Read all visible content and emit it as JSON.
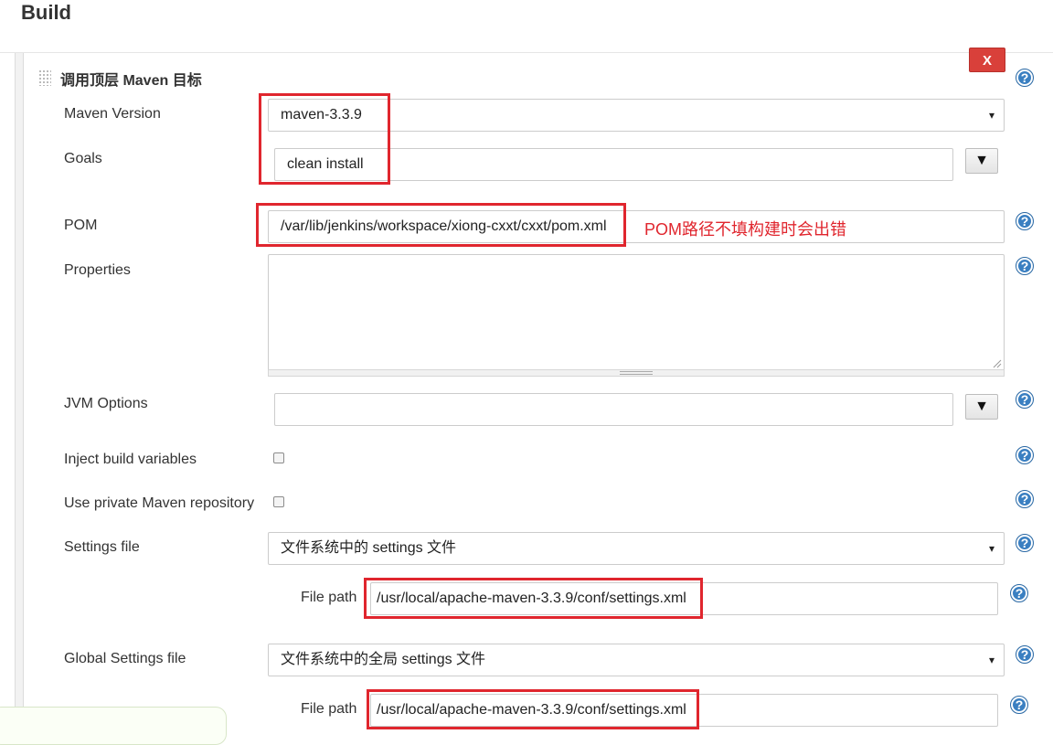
{
  "section": {
    "title": "Build"
  },
  "step": {
    "title": "调用顶层 Maven 目标",
    "delete_label": "X"
  },
  "help_label": "?",
  "fields": {
    "maven_version": {
      "label": "Maven Version",
      "value": "maven-3.3.9"
    },
    "goals": {
      "label": "Goals",
      "value": "clean install",
      "dropdown_glyph": "▼"
    },
    "pom": {
      "label": "POM",
      "value": "/var/lib/jenkins/workspace/xiong-cxxt/cxxt/pom.xml"
    },
    "properties": {
      "label": "Properties",
      "value": ""
    },
    "jvm_options": {
      "label": "JVM Options",
      "value": "",
      "dropdown_glyph": "▼"
    },
    "inject_build_variables": {
      "label": "Inject build variables",
      "checked": false
    },
    "use_private_repo": {
      "label": "Use private Maven repository",
      "checked": false
    },
    "settings_file": {
      "label": "Settings file",
      "value": "文件系统中的 settings 文件",
      "file_path_label": "File path",
      "file_path": "/usr/local/apache-maven-3.3.9/conf/settings.xml"
    },
    "global_settings_file": {
      "label": "Global Settings file",
      "value": "文件系统中的全局 settings 文件",
      "file_path_label": "File path",
      "file_path": "/usr/local/apache-maven-3.3.9/conf/settings.xml"
    }
  },
  "annotation": {
    "text": "POM路径不填构建时会出错",
    "color": "#e0262e"
  },
  "select_arrow": "▾",
  "colors": {
    "accent_help": "#3a7fc1",
    "delete": "#d9403a",
    "highlight": "#e0262e"
  }
}
